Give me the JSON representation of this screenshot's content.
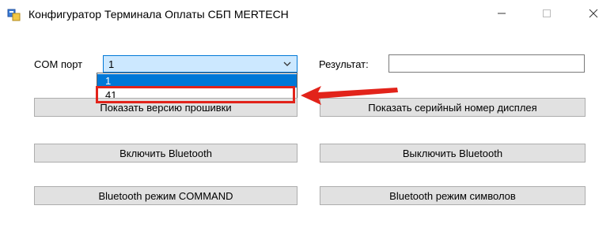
{
  "window": {
    "title": "Конфигуратор Терминала Оплаты СБП MERTECH"
  },
  "form": {
    "com_port_label": "COM порт",
    "com_port_value": "1",
    "com_port_options": [
      "1",
      "41"
    ],
    "result_label": "Результат:",
    "result_value": ""
  },
  "buttons": {
    "show_firmware": "Показать версию прошивки",
    "show_serial": "Показать серийный номер дисплея",
    "bt_on": "Включить Bluetooth",
    "bt_off": "Выключить Bluetooth",
    "bt_command": "Bluetooth режим COMMAND",
    "bt_symbols": "Bluetooth режим символов"
  },
  "colors": {
    "accent": "#0078d7",
    "annotation_red": "#e2231a",
    "button_face": "#e1e1e1"
  },
  "icons": [
    "app-icon",
    "minimize-icon",
    "maximize-icon",
    "close-icon",
    "chevron-down-icon",
    "annotation-arrow"
  ]
}
